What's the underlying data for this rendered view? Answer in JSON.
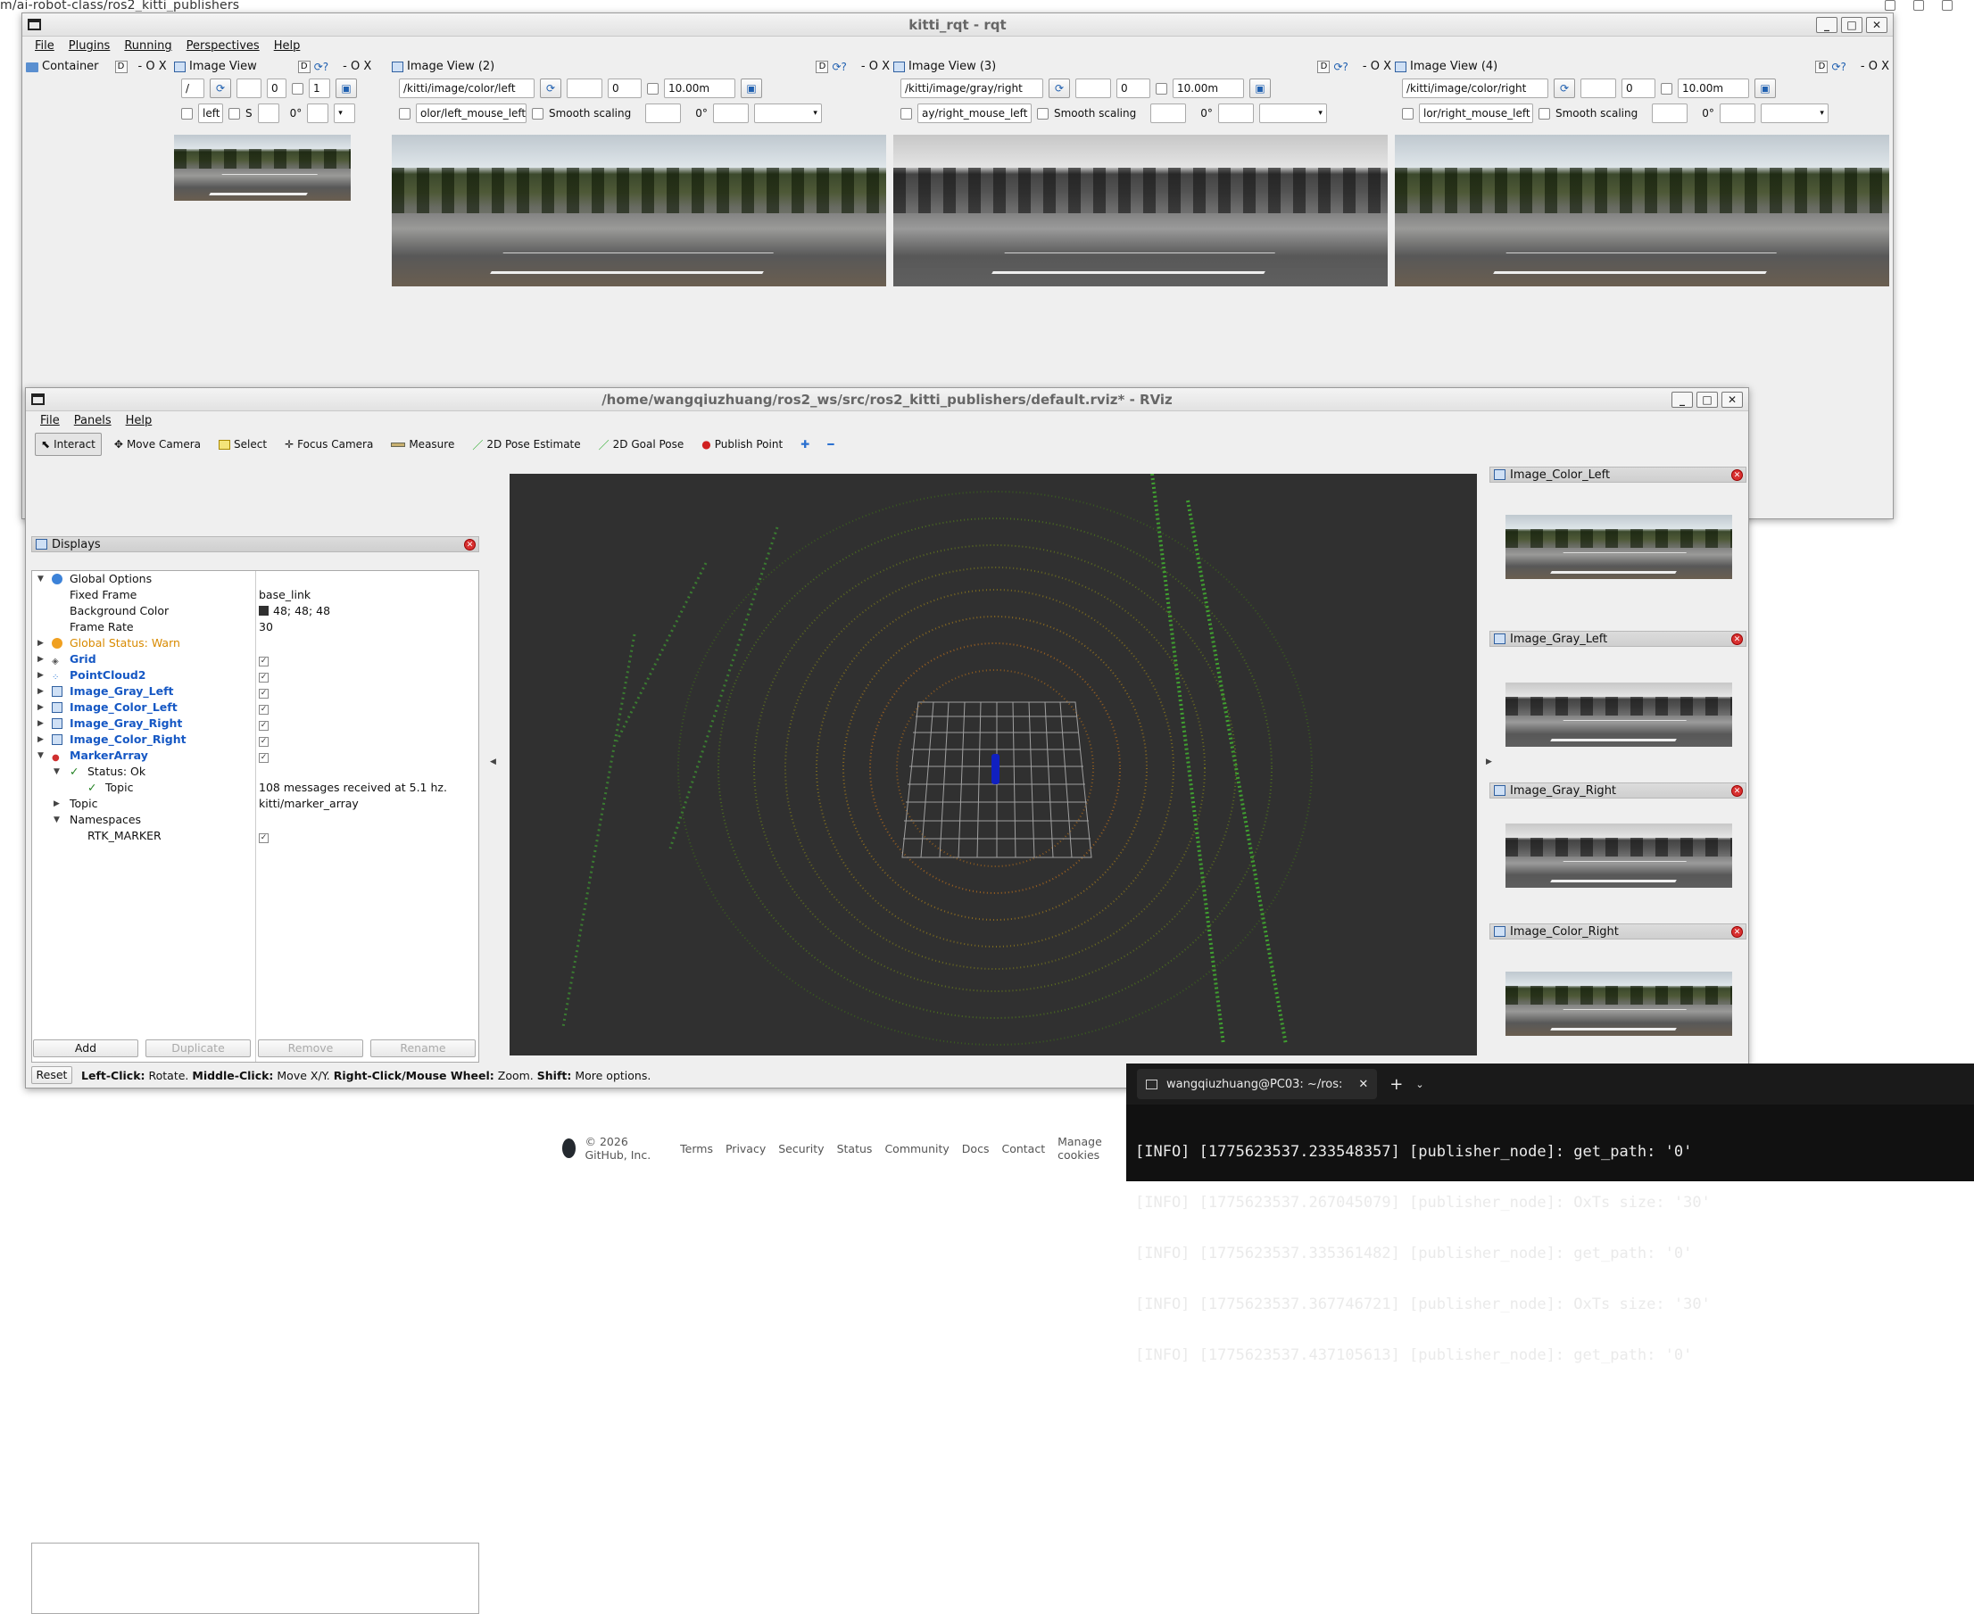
{
  "browser": {
    "url": "m/ai-robot-class/ros2_kitti_publishers"
  },
  "rqt": {
    "title": "kitti_rqt - rqt",
    "menu": [
      "File",
      "Plugins",
      "Running",
      "Perspectives",
      "Help"
    ],
    "container_label": "Container",
    "d_label": "D",
    "close_ox": "- O X",
    "views": [
      {
        "title": "Image View",
        "topic": "/",
        "num": "0",
        "num2": "1",
        "smooth": "",
        "mouse": "left",
        "extra": "S",
        "deg": "0°",
        "range": ""
      },
      {
        "title": "Image View (2)",
        "topic": "/kitti/image/color/left",
        "num": "0",
        "num2": "",
        "range": "10.00m",
        "mouse": "olor/left_mouse_left",
        "smooth": "Smooth scaling",
        "deg": "0°"
      },
      {
        "title": "Image View (3)",
        "topic": "/kitti/image/gray/right",
        "num": "0",
        "num2": "",
        "range": "10.00m",
        "mouse": "ay/right_mouse_left",
        "smooth": "Smooth scaling",
        "deg": "0°"
      },
      {
        "title": "Image View (4)",
        "topic": "/kitti/image/color/right",
        "num": "0",
        "num2": "",
        "range": "10.00m",
        "mouse": "lor/right_mouse_left",
        "smooth": "Smooth scaling",
        "deg": "0°"
      }
    ]
  },
  "rviz": {
    "title": "/home/wangqiuzhuang/ros2_ws/src/ros2_kitti_publishers/default.rviz* - RViz",
    "menu": [
      "File",
      "Panels",
      "Help"
    ],
    "tools": [
      "Interact",
      "Move Camera",
      "Select",
      "Focus Camera",
      "Measure",
      "2D Pose Estimate",
      "2D Goal Pose",
      "Publish Point"
    ],
    "displays_title": "Displays",
    "tree": {
      "global_options": "Global Options",
      "fixed_frame": "Fixed Frame",
      "fixed_frame_val": "base_link",
      "bg_color": "Background Color",
      "bg_color_val": "48; 48; 48",
      "frame_rate": "Frame Rate",
      "frame_rate_val": "30",
      "global_status": "Global Status: Warn",
      "grid": "Grid",
      "pointcloud": "PointCloud2",
      "img_gray_left": "Image_Gray_Left",
      "img_color_left": "Image_Color_Left",
      "img_gray_right": "Image_Gray_Right",
      "img_color_right": "Image_Color_Right",
      "marker_array": "MarkerArray",
      "status_ok": "Status: Ok",
      "topic": "Topic",
      "topic_msg": "108 messages received at 5.1 hz.",
      "topic2": "Topic",
      "topic_val": "kitti/marker_array",
      "namespaces": "Namespaces",
      "rtk_marker": "RTK_MARKER"
    },
    "buttons": {
      "add": "Add",
      "duplicate": "Duplicate",
      "remove": "Remove",
      "rename": "Rename"
    },
    "status": {
      "reset": "Reset",
      "help1": "Left-Click:",
      "help1t": " Rotate. ",
      "help2": "Middle-Click:",
      "help2t": " Move X/Y. ",
      "help3": "Right-Click/Mouse Wheel:",
      "help3t": " Zoom. ",
      "help4": "Shift:",
      "help4t": " More options."
    },
    "side_panels": [
      "Image_Color_Left",
      "Image_Gray_Left",
      "Image_Gray_Right",
      "Image_Color_Right"
    ],
    "colors": {
      "bg": "#303030",
      "grid": "#a0a0a0",
      "marker": "#1020c0"
    }
  },
  "terminal": {
    "tab": "wangqiuzhuang@PC03: ~/ros:",
    "lines": [
      "[INFO] [1775623537.233548357] [publisher_node]: get_path: '0'",
      "[INFO] [1775623537.267045079] [publisher_node]: OxTs size: '30'",
      "[INFO] [1775623537.335361482] [publisher_node]: get_path: '0'",
      "[INFO] [1775623537.367746721] [publisher_node]: OxTs size: '30'",
      "[INFO] [1775623537.437105613] [publisher_node]: get_path: '0'"
    ]
  },
  "footer": {
    "copyright": "© 2026 GitHub, Inc.",
    "links": [
      "Terms",
      "Privacy",
      "Security",
      "Status",
      "Community",
      "Docs",
      "Contact",
      "Manage cookies"
    ]
  }
}
